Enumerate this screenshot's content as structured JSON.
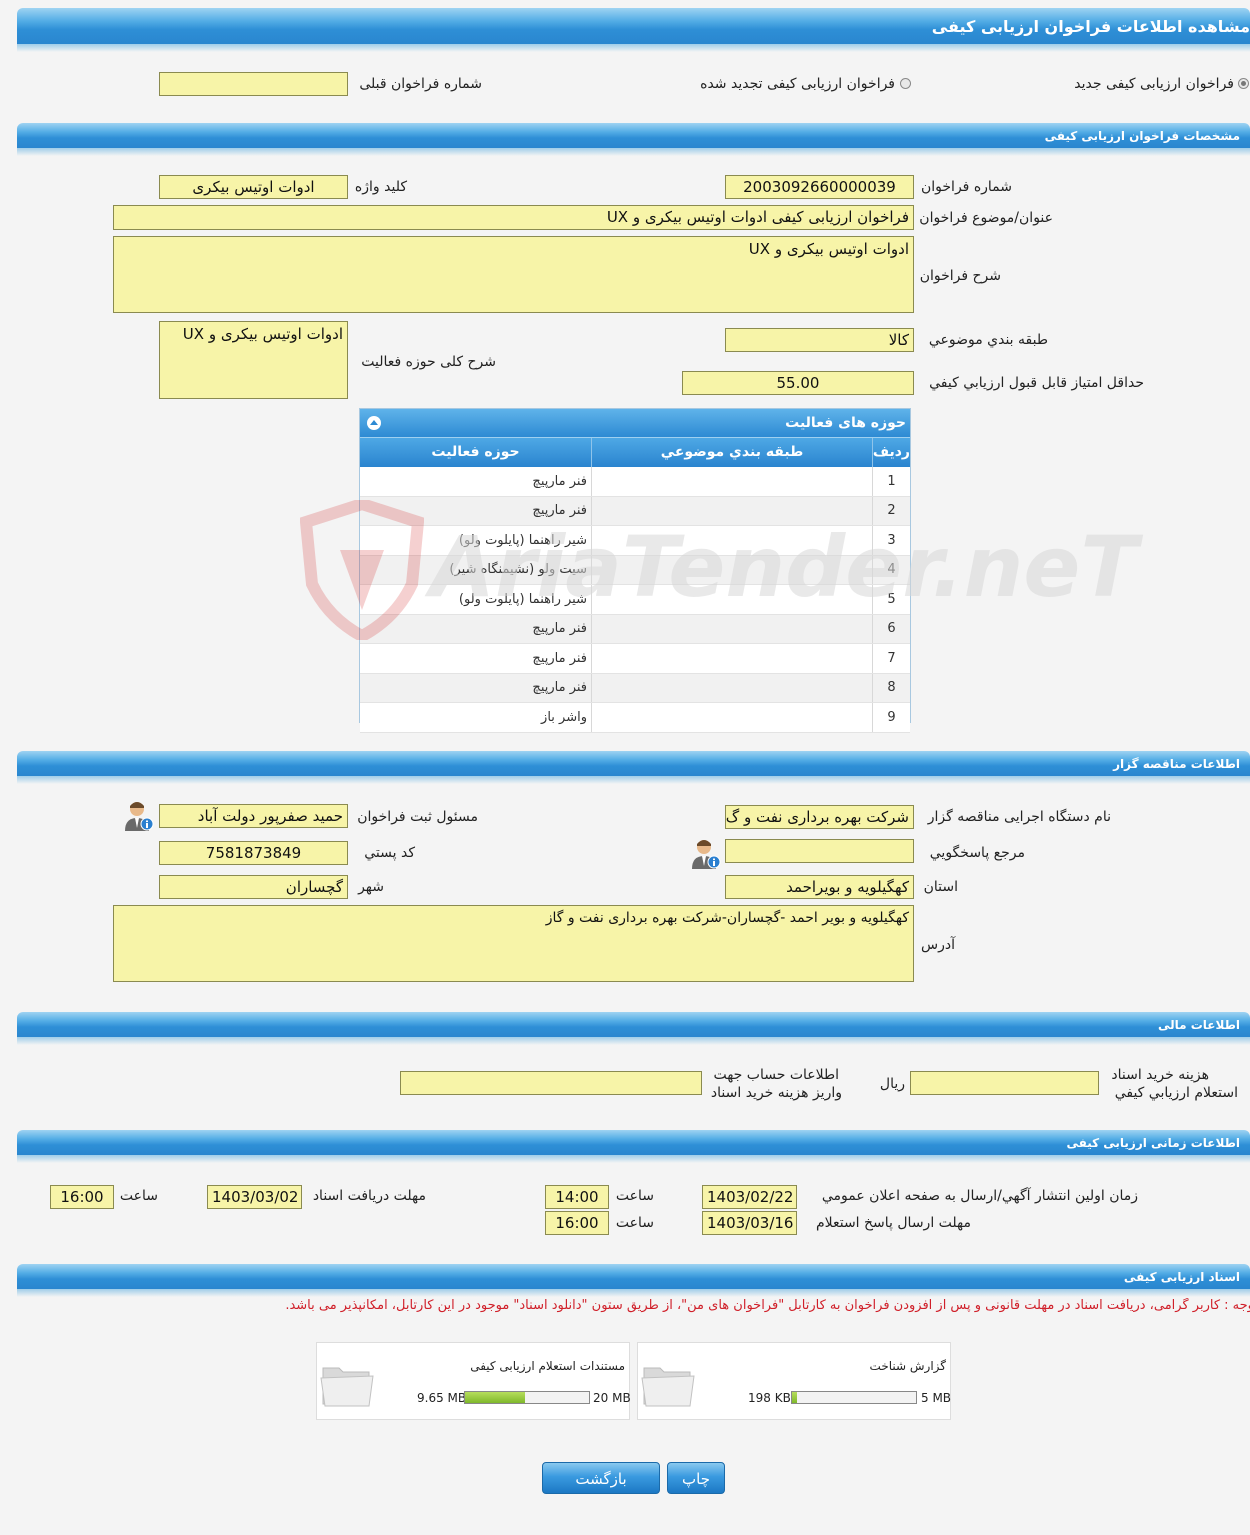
{
  "page_title": "مشاهده اطلاعات فراخوان ارزیابی کیفی",
  "call_type": {
    "new_label": "فراخوان ارزیابی کیفی جدید",
    "renewed_label": "فراخوان ارزیابی کیفی تجدید شده",
    "prev_number_label": "شماره فراخوان قبلی",
    "prev_number_value": ""
  },
  "specs": {
    "section_title": "مشخصات فراخوان ارزیابی کیفی",
    "call_number_label": "شماره فراخوان",
    "call_number": "2003092660000039",
    "keyword_label": "کلید واژه",
    "keyword": "ادوات اوتیس بیکری",
    "subject_label": "عنوان/موضوع فراخوان",
    "subject": "فراخوان ارزیابی کیفی ادوات اوتیس بیکری و UX",
    "description_label": "شرح فراخوان",
    "description": "ادوات اوتیس بیکری و UX",
    "category_label": "طبقه بندي موضوعي",
    "category": "کالا",
    "min_score_label": "حداقل امتياز قابل قبول ارزيابي کيفي",
    "min_score": "55.00",
    "activity_desc_label": "شرح کلی حوزه فعالیت",
    "activity_desc": "ادوات اوتیس بیکری و UX"
  },
  "activity_table": {
    "title": "حوزه های فعالیت",
    "col_row": "ردیف",
    "col_category": "طبقه بندي موضوعي",
    "col_field": "حوزه فعالیت",
    "rows": [
      {
        "n": "1",
        "category": "",
        "field": "فنر مارپیچ"
      },
      {
        "n": "2",
        "category": "",
        "field": "فنر مارپیچ"
      },
      {
        "n": "3",
        "category": "",
        "field": "شیر راهنما (پایلوت ولو)"
      },
      {
        "n": "4",
        "category": "",
        "field": "سیت ولو (نشیمنگاه شیر)"
      },
      {
        "n": "5",
        "category": "",
        "field": "شیر راهنما (پایلوت ولو)"
      },
      {
        "n": "6",
        "category": "",
        "field": "فنر مارپیچ"
      },
      {
        "n": "7",
        "category": "",
        "field": "فنر مارپیچ"
      },
      {
        "n": "8",
        "category": "",
        "field": "فنر مارپیچ"
      },
      {
        "n": "9",
        "category": "",
        "field": "واشر باز"
      }
    ]
  },
  "watermark": "AriaTender.neT",
  "tenderer": {
    "section_title": "اطلاعات مناقصه گزار",
    "org_label": "نام دستگاه اجرایی مناقصه گزار",
    "org": "شرکت بهره برداری نفت و گ",
    "registrar_label": "مسئول ثبت فراخوان",
    "registrar": "حمید صفرپور دولت آباد",
    "reference_label": "مرجع پاسخگويي",
    "reference": "",
    "postal_label": "کد پستي",
    "postal": "7581873849",
    "province_label": "استان",
    "province": "کهگیلویه و بویراحمد",
    "city_label": "شهر",
    "city": "گچساران",
    "address_label": "آدرس",
    "address": "کهگیلویه و بویر احمد -گچساران-شرکت بهره برداری نفت و گاز"
  },
  "financial": {
    "section_title": "اطلاعات مالی",
    "cost_label_1": "هزینه خرید اسناد",
    "cost_label_2": "استعلام ارزيابي کيفي",
    "cost_value": "",
    "currency": "ريال",
    "account_label_1": "اطلاعات حساب جهت",
    "account_label_2": "واریز هزینه خرید اسناد",
    "account_value": ""
  },
  "timing": {
    "section_title": "اطلاعات زمانی ارزیابی کیفی",
    "publish_label": "زمان اولین انتشار آگهي/ارسال به صفحه اعلان عمومي",
    "publish_date": "1403/02/22",
    "hour_label": "ساعت",
    "publish_time": "14:00",
    "doc_deadline_label": "مهلت دریافت اسناد",
    "doc_deadline_date": "1403/03/02",
    "doc_deadline_time": "16:00",
    "reply_deadline_label": "مهلت ارسال پاسخ استعلام",
    "reply_deadline_date": "1403/03/16",
    "reply_deadline_time": "16:00"
  },
  "documents": {
    "section_title": "اسناد ارزیابی کیفی",
    "notice": "توجه : کاربر گرامی، دریافت اسناد در مهلت قانونی و پس از افزودن فراخوان به کارتابل \"فراخوان های من\"، از طریق ستون \"دانلود اسناد\" موجود در این کارتابل، امکانپذیر می باشد.",
    "items": [
      {
        "name": "گزارش شناخت",
        "size": "198 KB",
        "max": "5 MB",
        "fill": 0.04
      },
      {
        "name": "مستندات استعلام ارزیابی کیفی",
        "size": "9.65 MB",
        "max": "20 MB",
        "fill": 0.48
      }
    ]
  },
  "buttons": {
    "print": "چاپ",
    "back": "بازگشت"
  }
}
